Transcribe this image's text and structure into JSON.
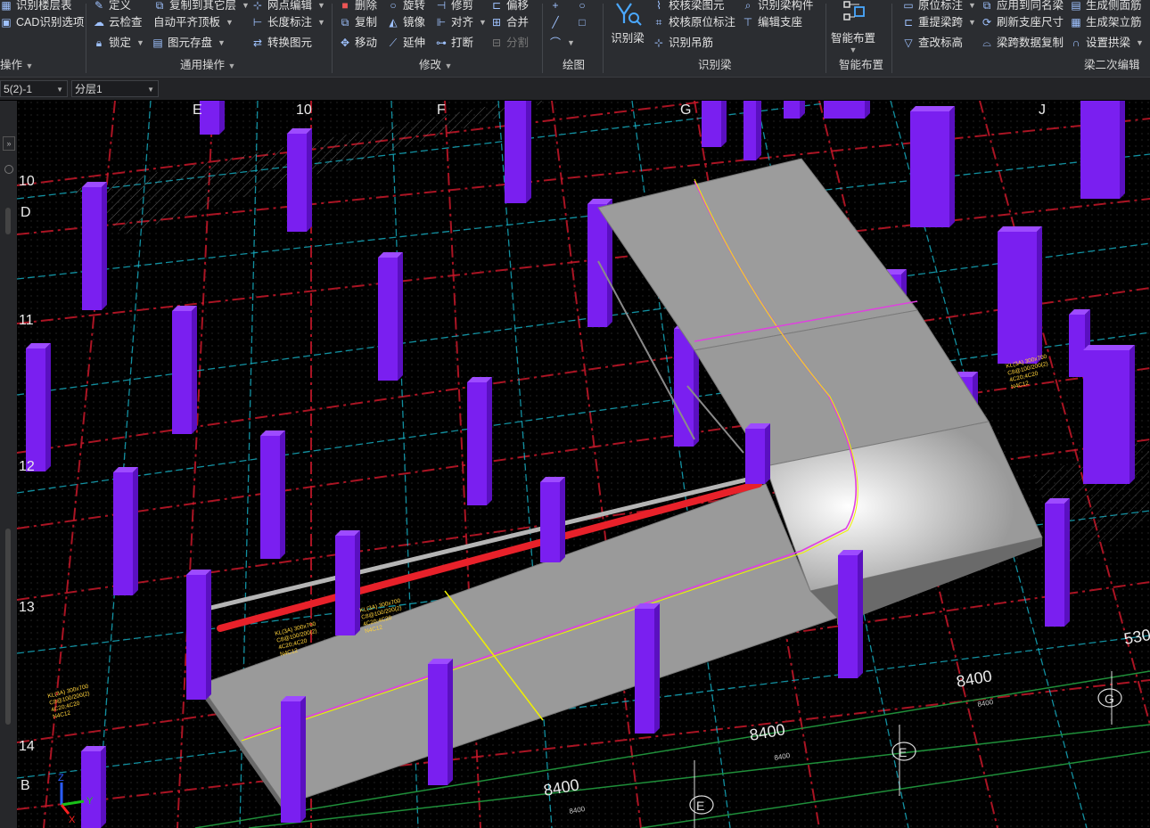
{
  "ribbon": {
    "row_items": [
      {
        "label": "识别楼层表",
        "icon": "table-icon"
      },
      {
        "label": "CAD识别选项",
        "icon": "cad-options-icon"
      },
      {
        "label": "定义",
        "icon": "define-icon"
      },
      {
        "label": "复制到其它层",
        "icon": "copy-layer-icon"
      },
      {
        "label": "云检查",
        "icon": "cloud-check-icon"
      },
      {
        "label": "自动平齐顶板",
        "icon": "align-top-icon"
      },
      {
        "label": "锁定",
        "icon": "lock-icon"
      },
      {
        "label": "图元存盘",
        "icon": "save-element-icon"
      },
      {
        "label": "网点编辑",
        "icon": "grid-edit-icon"
      },
      {
        "label": "长度标注",
        "icon": "dimension-icon"
      },
      {
        "label": "转换图元",
        "icon": "convert-icon"
      },
      {
        "label": "删除",
        "icon": "delete-icon"
      },
      {
        "label": "旋转",
        "icon": "rotate-icon"
      },
      {
        "label": "修剪",
        "icon": "trim-icon"
      },
      {
        "label": "偏移",
        "icon": "offset-icon"
      },
      {
        "label": "复制",
        "icon": "copy-icon"
      },
      {
        "label": "镜像",
        "icon": "mirror-icon"
      },
      {
        "label": "对齐",
        "icon": "align-icon"
      },
      {
        "label": "合并",
        "icon": "merge-icon"
      },
      {
        "label": "移动",
        "icon": "move-icon"
      },
      {
        "label": "延伸",
        "icon": "extend-icon"
      },
      {
        "label": "打断",
        "icon": "break-icon"
      },
      {
        "label": "分割",
        "icon": "split-icon"
      },
      {
        "label": "校核梁图元",
        "icon": "check-beam-icon"
      },
      {
        "label": "识别梁构件",
        "icon": "identify-beam-part-icon"
      },
      {
        "label": "校核原位标注",
        "icon": "check-annotation-icon"
      },
      {
        "label": "编辑支座",
        "icon": "edit-support-icon"
      },
      {
        "label": "识别吊筋",
        "icon": "hanger-icon"
      },
      {
        "label": "原位标注",
        "icon": "in-place-annotation-icon"
      },
      {
        "label": "应用到同名梁",
        "icon": "apply-same-beam-icon"
      },
      {
        "label": "生成侧面筋",
        "icon": "side-rebar-icon"
      },
      {
        "label": "重提梁跨",
        "icon": "respan-icon"
      },
      {
        "label": "刷新支座尺寸",
        "icon": "refresh-support-icon"
      },
      {
        "label": "生成架立筋",
        "icon": "erection-rebar-icon"
      },
      {
        "label": "查改标高",
        "icon": "elevation-icon"
      },
      {
        "label": "梁跨数据复制",
        "icon": "span-copy-icon"
      },
      {
        "label": "设置拱梁",
        "icon": "arch-beam-icon"
      }
    ],
    "big_buttons": [
      {
        "label": "识别梁",
        "icon": "identify-beam-icon"
      },
      {
        "label": "智能布置",
        "icon": "smart-layout-icon"
      }
    ],
    "groups": [
      "操作",
      "通用操作",
      "修改",
      "绘图",
      "识别梁",
      "智能布置",
      "梁二次编辑"
    ]
  },
  "toolbar2": {
    "layer_combo": "5(2)-1",
    "sublayer_combo": "分层1"
  },
  "viewport": {
    "axis_rows": [
      "10",
      "D",
      "11",
      "12",
      "13",
      "14",
      "B"
    ],
    "axis_cols": [
      "E",
      "10",
      "F",
      "G",
      "J"
    ],
    "bottom_circles": [
      "E",
      "E",
      "G"
    ],
    "dims": [
      "8400",
      "8400",
      "8400",
      "530"
    ],
    "small_dims": [
      "8400",
      "8400",
      "8400"
    ],
    "coord_axes": [
      "Z",
      "Y",
      "X"
    ],
    "cad_notes": [
      "KL(3A) 300x700",
      "C8@100/200(2)",
      "4C20;4C20",
      "N4C12"
    ],
    "colors": {
      "column": "#7a1ff0",
      "slab": "#9a9a9a",
      "beam_selected": "#e8212a",
      "grid_red": "#c8182a",
      "grid_cyan": "#17b4c9",
      "axis_green": "#1f8f3a",
      "magenta_line": "#e040e0",
      "yellow_line": "#f0f000"
    }
  }
}
